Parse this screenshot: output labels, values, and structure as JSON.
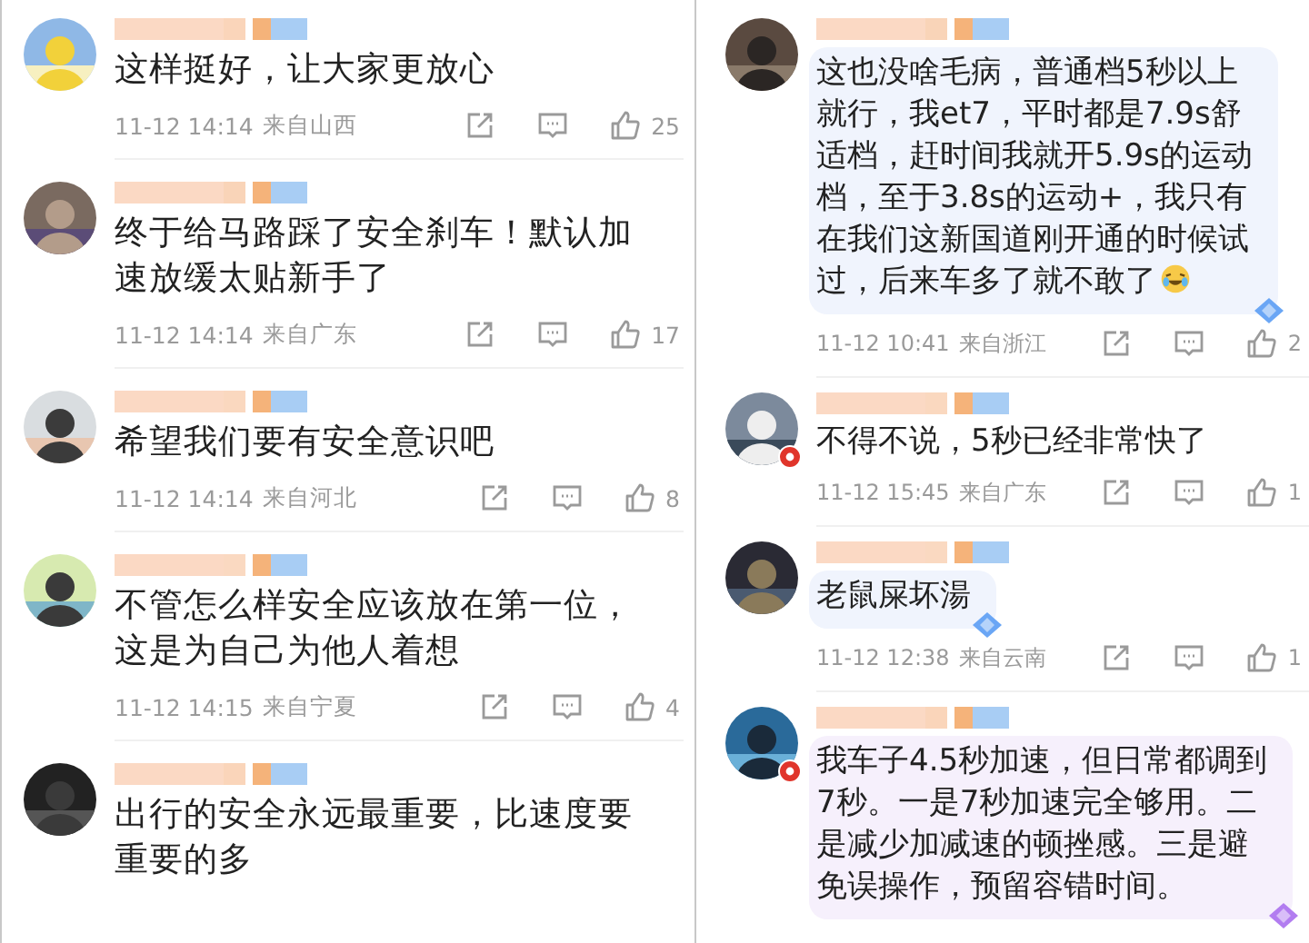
{
  "columns": [
    {
      "comments": [
        {
          "text_lines": [
            "这样挺好，让大家更放心"
          ],
          "kind": "plain",
          "verified": false,
          "time": "11-12 14:14",
          "location": "来自山西",
          "likes": "25"
        },
        {
          "text_lines": [
            "终于给马路踩了安全刹车！默认加",
            "速放缓太贴新手了"
          ],
          "kind": "plain",
          "verified": false,
          "time": "11-12 14:14",
          "location": "来自广东",
          "likes": "17"
        },
        {
          "text_lines": [
            "希望我们要有安全意识吧"
          ],
          "kind": "plain",
          "verified": false,
          "time": "11-12 14:14",
          "location": "来自河北",
          "likes": "8"
        },
        {
          "text_lines": [
            "不管怎么样安全应该放在第一位，",
            "这是为自己为他人着想"
          ],
          "kind": "plain",
          "verified": false,
          "time": "11-12 14:15",
          "location": "来自宁夏",
          "likes": "4"
        },
        {
          "text_lines": [
            "出行的安全永远最重要，比速度要",
            "重要的多"
          ],
          "kind": "plain",
          "verified": false
        }
      ]
    },
    {
      "comments": [
        {
          "text_lines": [
            "这也没啥毛病，普通档5秒以上",
            "就行，我et7，平时都是7.9s舒",
            "适档，赶时间我就开5.9s的运动",
            "档，至于3.8s的运动+，我只有",
            "在我们这新国道刚开通的时候试",
            "过，后来车多了就不敢了"
          ],
          "laugh_emoji": true,
          "kind": "blue-bubble",
          "verified": false,
          "time": "11-12 10:41",
          "location": "来自浙江",
          "likes": "2"
        },
        {
          "text_lines": [
            "不得不说，5秒已经非常快了"
          ],
          "kind": "plain",
          "verified": true,
          "time": "11-12 15:45",
          "location": "来自广东",
          "likes": "1"
        },
        {
          "text_lines": [
            "老鼠屎坏湯"
          ],
          "kind": "blue-bubble",
          "verified": false,
          "time": "11-12 12:38",
          "location": "来自云南",
          "likes": "1"
        },
        {
          "text_lines": [
            "我车子4.5秒加速，但日常都调到",
            "7秒。一是7秒加速完全够用。二",
            "是减少加减速的顿挫感。三是避",
            "免误操作，预留容错时间。"
          ],
          "kind": "purple-bubble",
          "verified": true
        }
      ]
    }
  ]
}
